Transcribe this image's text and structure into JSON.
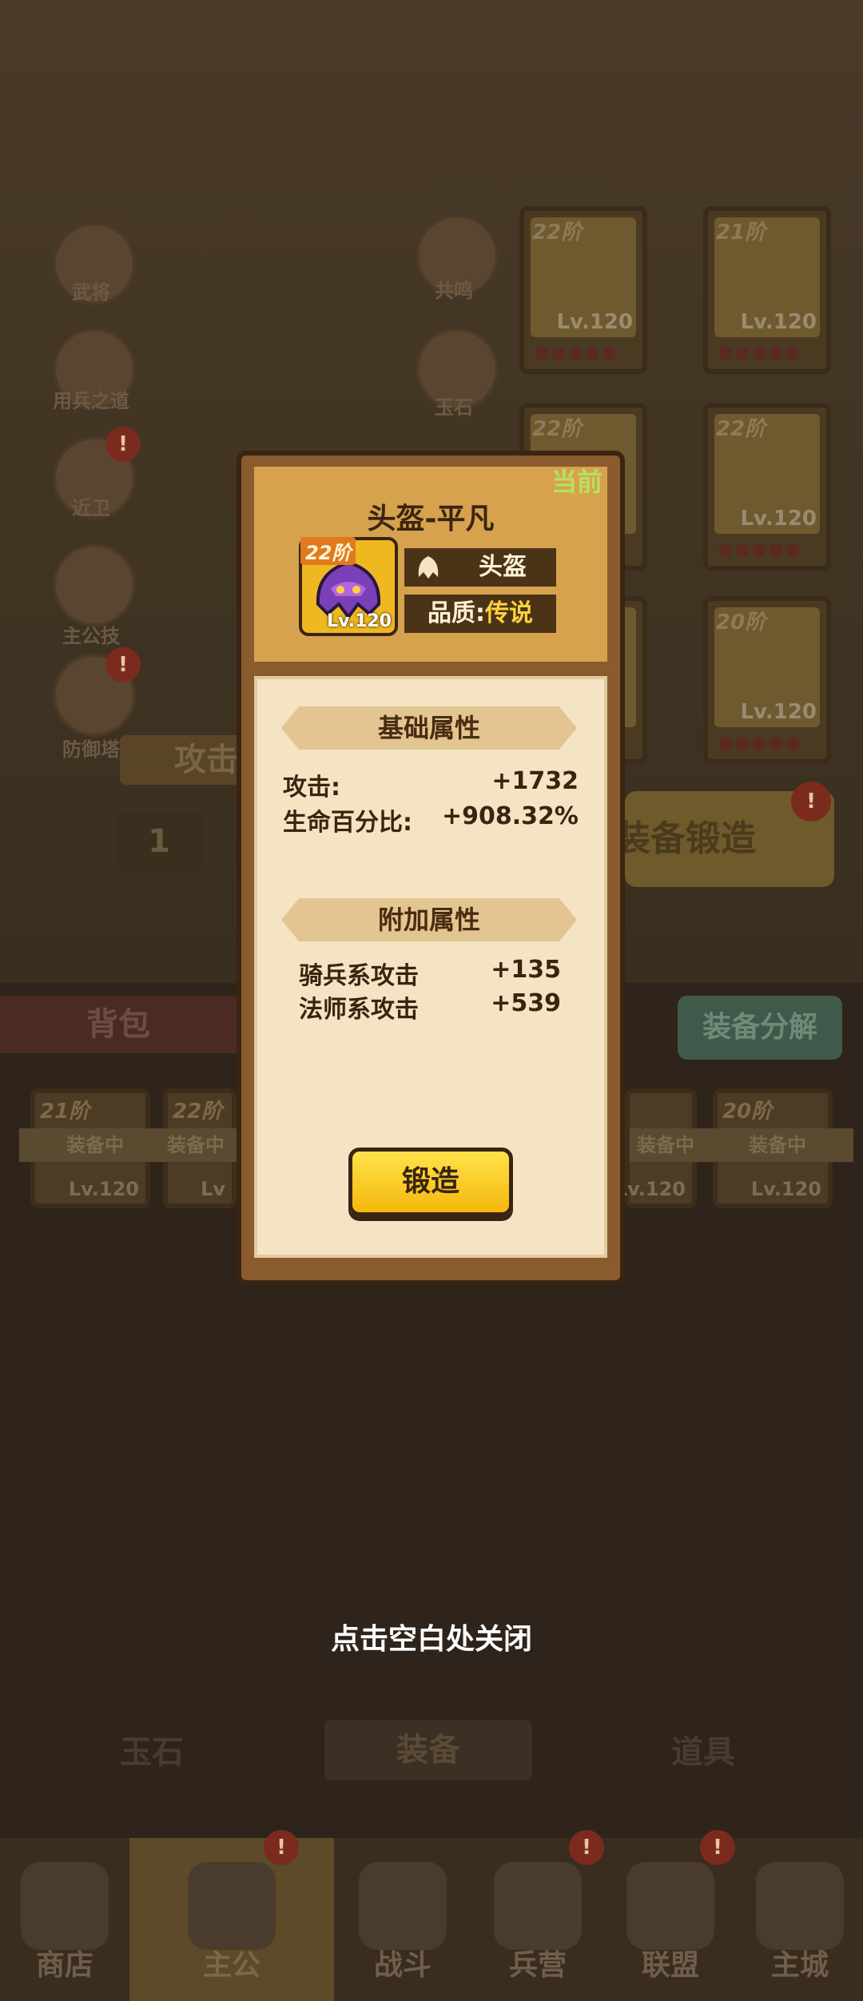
{
  "background": {
    "left_menu": [
      {
        "label": "武将",
        "badge": ""
      },
      {
        "label": "用兵之道",
        "badge": ""
      },
      {
        "label": "近卫",
        "badge": "!"
      },
      {
        "label": "主公技",
        "badge": ""
      },
      {
        "label": "防御塔",
        "badge": "!"
      }
    ],
    "middle_menu": [
      {
        "label": "共鸣"
      },
      {
        "label": "玉石"
      }
    ],
    "equip_cards": [
      {
        "tier": "22阶",
        "level": "Lv.120"
      },
      {
        "tier": "21阶",
        "level": "Lv.120"
      },
      {
        "tier": "22阶",
        "level": ""
      },
      {
        "tier": "22阶",
        "level": "Lv.120"
      },
      {
        "tier": "",
        "level": ""
      },
      {
        "tier": "20阶",
        "level": "Lv.120"
      }
    ],
    "attack_label": "攻击",
    "count_value": "1",
    "forge_equip_button": "装备锻造",
    "forge_badge": "!",
    "bag_title": "背包",
    "decompose_button": "装备分解",
    "bag_items": [
      {
        "tier": "21阶",
        "status": "装备中",
        "level": "Lv.120"
      },
      {
        "tier": "22阶",
        "status": "装备中",
        "level": "Lv"
      },
      {
        "tier": "",
        "status": "装备中",
        "level": "Lv.120"
      },
      {
        "tier": "20阶",
        "status": "装备中",
        "level": "Lv.120"
      }
    ],
    "bag_tabs": [
      "玉石",
      "装备",
      "道具"
    ]
  },
  "bottom_nav": [
    {
      "label": "商店",
      "badge": ""
    },
    {
      "label": "主公",
      "badge": "!"
    },
    {
      "label": "战斗",
      "badge": ""
    },
    {
      "label": "兵营",
      "badge": "!"
    },
    {
      "label": "联盟",
      "badge": "!"
    },
    {
      "label": "主城",
      "badge": ""
    }
  ],
  "modal": {
    "current_tag": "当前",
    "title": "头盔-平凡",
    "item": {
      "tier": "22阶",
      "level": "Lv.120",
      "icon": "helmet-icon"
    },
    "type_label": "头盔",
    "quality_label": "品质:",
    "quality_value": "传说",
    "base_section": "基础属性",
    "base_stats": [
      {
        "name": "攻击:",
        "value": "+1732"
      },
      {
        "name": "生命百分比:",
        "value": "+908.32%"
      }
    ],
    "extra_section": "附加属性",
    "extra_stats": [
      {
        "name": "骑兵系攻击",
        "value": "+135"
      },
      {
        "name": "法师系攻击",
        "value": "+539"
      }
    ],
    "forge_button": "锻造"
  },
  "close_hint": "点击空白处关闭",
  "colors": {
    "quality_legendary": "#ffd23a",
    "current_tag": "#b7e05e",
    "button_yellow": "#f5b80c"
  }
}
